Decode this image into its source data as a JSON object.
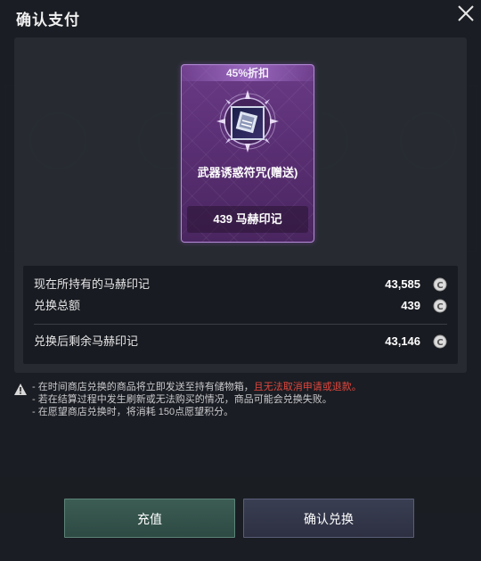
{
  "dialog": {
    "title": "确认支付"
  },
  "item": {
    "discount": "45%折扣",
    "name": "武器诱惑符咒(赠送)",
    "price": "439 马赫印记"
  },
  "summary": {
    "held_label": "现在所持有的马赫印记",
    "held_value": "43,585",
    "total_label": "兑换总额",
    "total_value": "439",
    "remaining_label": "兑换后剩余马赫印记",
    "remaining_value": "43,146"
  },
  "notice": {
    "line1_prefix": "- 在时间商店兑换的商品将立即发送至持有储物箱，",
    "line1_warning": "且无法取消申请或退款。",
    "line2": "- 若在结算过程中发生刷新或无法购买的情况，商品可能会兑换失败。",
    "line3": "- 在愿望商店兑换时，将消耗 150点愿望积分。"
  },
  "buttons": {
    "recharge": "充值",
    "confirm": "确认兑换"
  },
  "colors": {
    "card_border": "#b58ad8",
    "card_bg": "#5a2f74",
    "warning": "#e0473e",
    "recharge_bg": "#3c5d54",
    "confirm_bg": "#3a3e52"
  }
}
